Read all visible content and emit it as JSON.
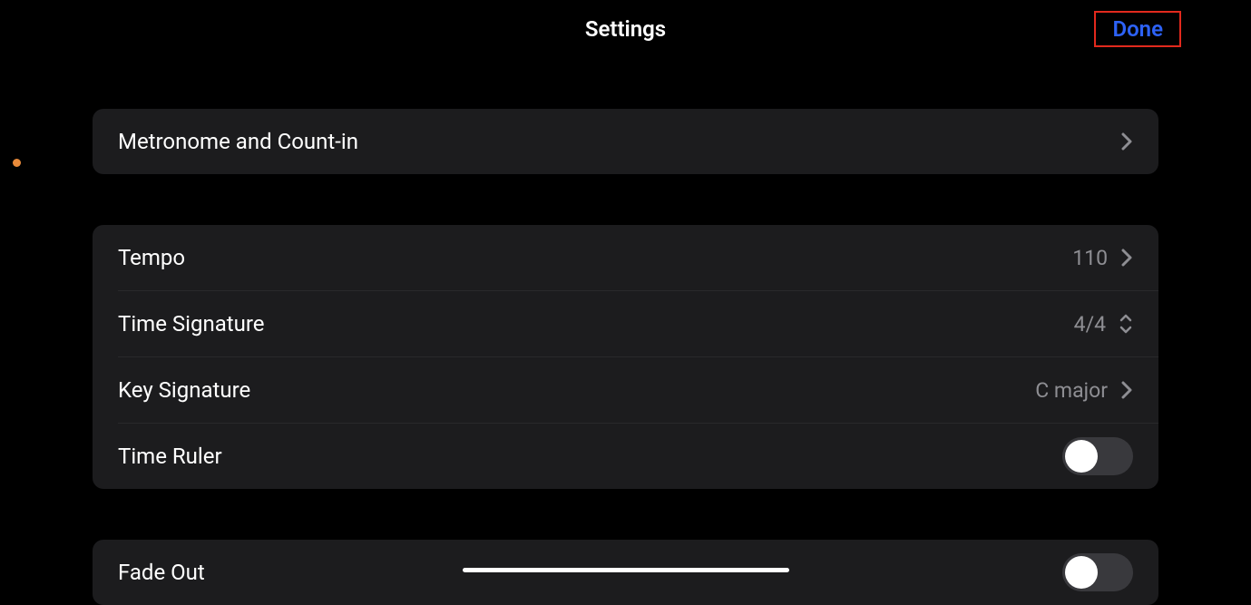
{
  "header": {
    "title": "Settings",
    "done_label": "Done"
  },
  "sections": {
    "metronome": {
      "label": "Metronome and Count-in"
    },
    "song": {
      "tempo_label": "Tempo",
      "tempo_value": "110",
      "timesig_label": "Time Signature",
      "timesig_value": "4/4",
      "keysig_label": "Key Signature",
      "keysig_value": "C major",
      "timeruler_label": "Time Ruler",
      "timeruler_on": false
    },
    "fade": {
      "fadeout_label": "Fade Out",
      "fadeout_on": false
    }
  }
}
